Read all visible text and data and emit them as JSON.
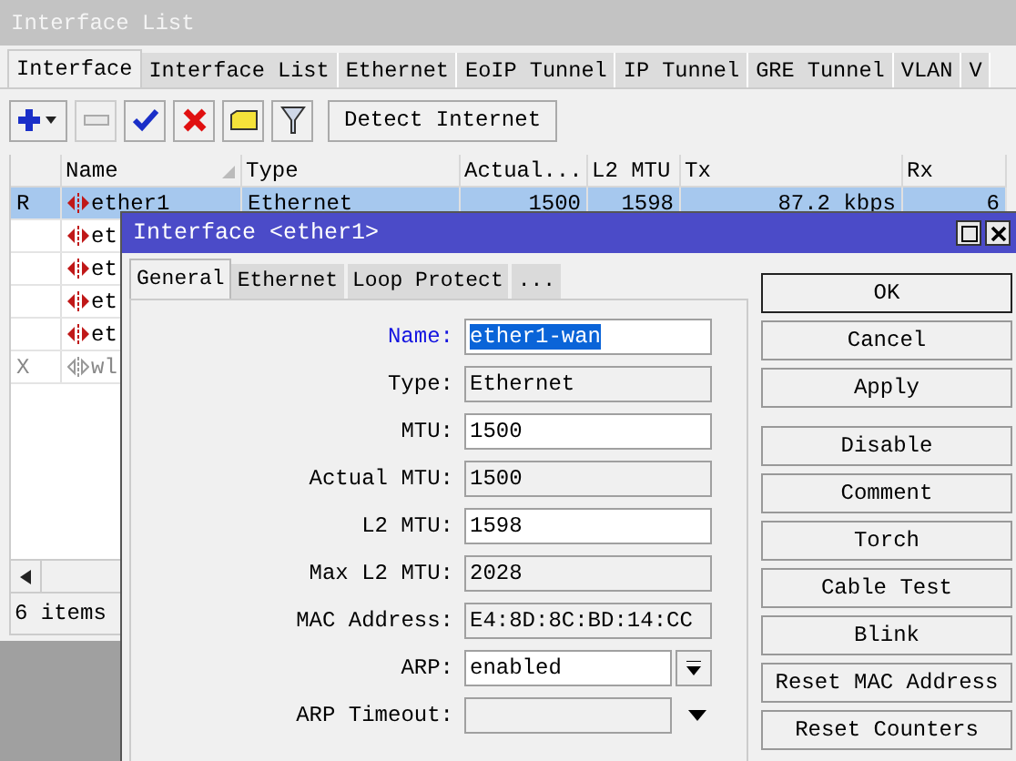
{
  "window": {
    "title": "Interface List"
  },
  "tabs": [
    {
      "label": "Interface",
      "selected": true
    },
    {
      "label": "Interface List",
      "selected": false
    },
    {
      "label": "Ethernet",
      "selected": false
    },
    {
      "label": "EoIP Tunnel",
      "selected": false
    },
    {
      "label": "IP Tunnel",
      "selected": false
    },
    {
      "label": "GRE Tunnel",
      "selected": false
    },
    {
      "label": "VLAN",
      "selected": false
    },
    {
      "label": "V",
      "selected": false
    }
  ],
  "toolbar": {
    "buttons": [
      {
        "kind": "add",
        "disabled": false
      },
      {
        "kind": "remove",
        "disabled": true
      },
      {
        "kind": "enable",
        "disabled": false
      },
      {
        "kind": "disable",
        "disabled": false
      },
      {
        "kind": "comment",
        "disabled": false
      },
      {
        "kind": "filter",
        "disabled": false
      }
    ],
    "detect_button": "Detect Internet"
  },
  "table": {
    "columns": [
      {
        "label": "Name",
        "sorted": true
      },
      {
        "label": "Type",
        "sorted": false
      },
      {
        "label": "Actual...",
        "sorted": false
      },
      {
        "label": "L2 MTU",
        "sorted": false
      },
      {
        "label": "Tx",
        "sorted": false
      },
      {
        "label": "Rx",
        "sorted": false
      }
    ],
    "rows": [
      {
        "flag": "R",
        "cells": [
          "ether1",
          "Ethernet",
          "1500",
          "1598",
          "87.2 kbps",
          "6"
        ],
        "selected": true,
        "disabled": false
      },
      {
        "cells": [
          "et"
        ],
        "selected": false,
        "disabled": false
      },
      {
        "cells": [
          "et"
        ],
        "selected": false,
        "disabled": false
      },
      {
        "cells": [
          "et"
        ],
        "selected": false,
        "disabled": false
      },
      {
        "cells": [
          "et"
        ],
        "selected": false,
        "disabled": false
      },
      {
        "flag": "X",
        "cells": [
          "wl"
        ],
        "selected": false,
        "disabled": true
      }
    ]
  },
  "status_bar": "6 items",
  "dialog": {
    "title": "Interface <ether1>",
    "tabs": [
      {
        "label": "General",
        "selected": true
      },
      {
        "label": "Ethernet",
        "selected": false
      },
      {
        "label": "Loop Protect",
        "selected": false
      },
      {
        "label": "...",
        "selected": false
      }
    ],
    "fields": [
      {
        "label": "Name:",
        "kind": "input",
        "value": "ether1-wan",
        "focused": true
      },
      {
        "label": "Type:",
        "kind": "readonly",
        "value": "Ethernet",
        "focused": false
      },
      {
        "label": "MTU:",
        "kind": "input",
        "value": "1500",
        "focused": false
      },
      {
        "label": "Actual MTU:",
        "kind": "readonly",
        "value": "1500",
        "focused": false
      },
      {
        "label": "L2 MTU:",
        "kind": "input",
        "value": "1598",
        "focused": false
      },
      {
        "label": "Max L2 MTU:",
        "kind": "readonly",
        "value": "2028",
        "focused": false
      },
      {
        "label": "MAC Address:",
        "kind": "readonly",
        "value": "E4:8D:8C:BD:14:CC",
        "focused": false
      },
      {
        "label": "ARP:",
        "kind": "select",
        "value": "enabled",
        "focused": false
      },
      {
        "label": "ARP Timeout:",
        "kind": "dropdown",
        "focused": false
      }
    ],
    "main_buttons": [
      {
        "label": "OK",
        "default": true
      },
      {
        "label": "Cancel",
        "default": false
      },
      {
        "label": "Apply",
        "default": false
      }
    ],
    "action_buttons": [
      "Disable",
      "Comment",
      "Torch",
      "Cable Test",
      "Blink",
      "Reset MAC Address",
      "Reset Counters"
    ]
  }
}
